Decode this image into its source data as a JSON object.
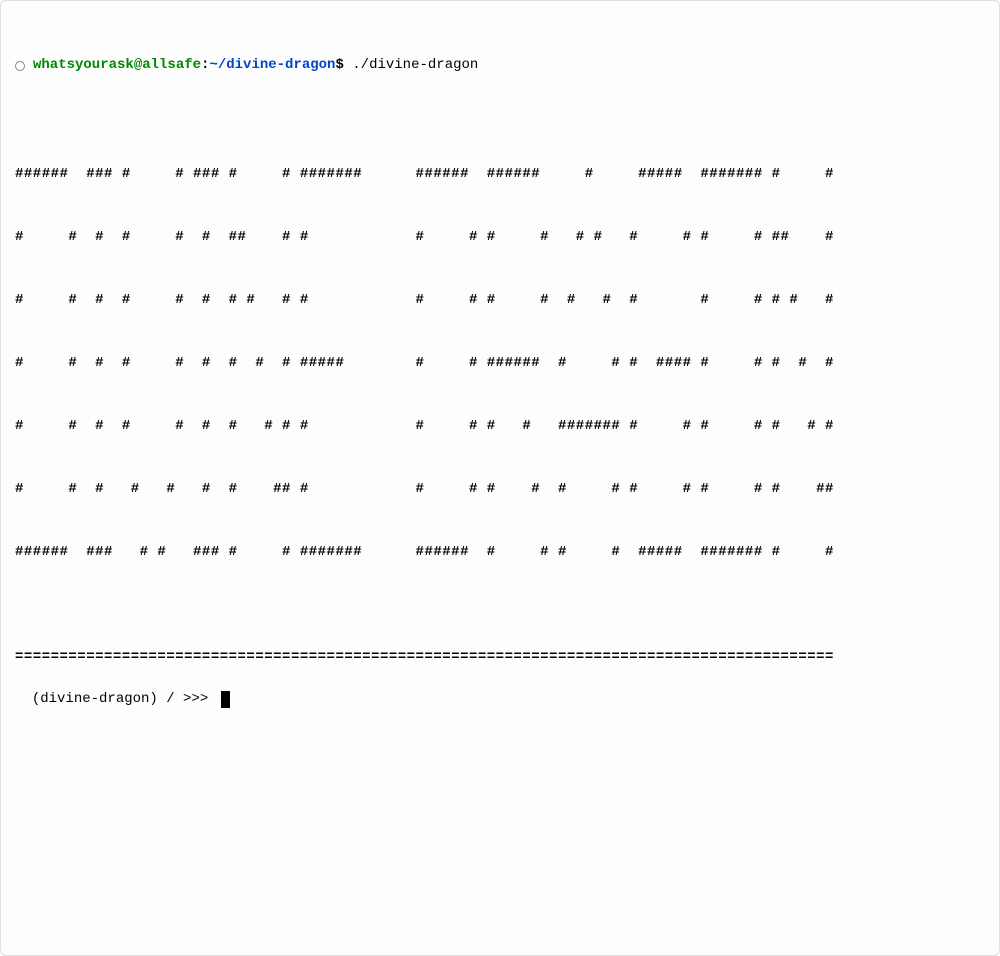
{
  "shell": {
    "user_host": "whatsyourask@allsafe",
    "colon": ":",
    "path": "~/divine-dragon",
    "dollar": "$",
    "command": " ./divine-dragon"
  },
  "ascii_art": [
    "######  ### #     # ### #     # #######      ######  ######     #     #####  ####### #     #",
    "#     #  #  #     #  #  ##    # #            #     # #     #   # #   #     # #     # ##    #",
    "#     #  #  #     #  #  # #   # #            #     # #     #  #   #  #       #     # # #   #",
    "#     #  #  #     #  #  #  #  # #####        #     # ######  #     # #  #### #     # #  #  #",
    "#     #  #  #     #  #  #   # # #            #     # #   #   ####### #     # #     # #   # #",
    "#     #  #   #   #   #  #    ## #            #     # #    #  #     # #     # #     # #    ##",
    "######  ###   # #   ### #     # #######      ######  #     # #     #  #####  ####### #     #"
  ],
  "divider": "============================================================================================",
  "repl": {
    "prompt": "(divine-dragon) / >>> "
  }
}
